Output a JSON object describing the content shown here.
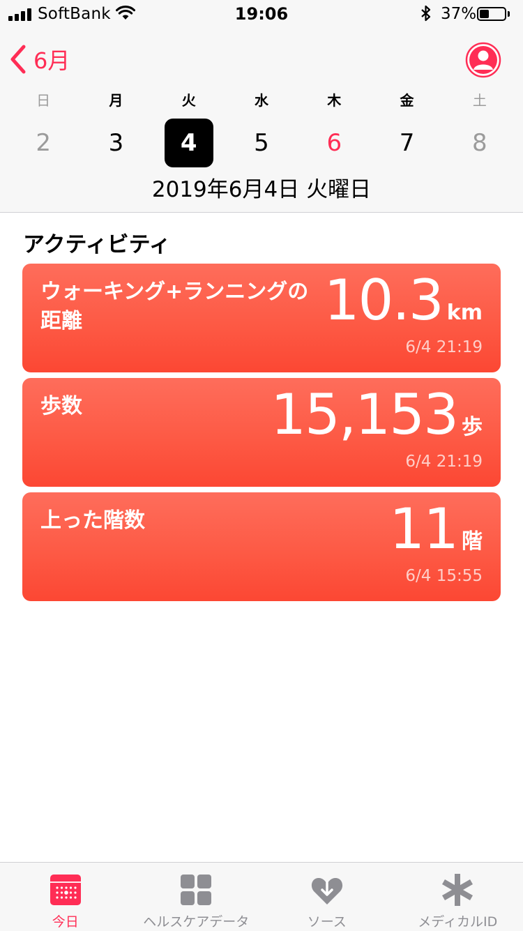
{
  "status_bar": {
    "carrier": "SoftBank",
    "time": "19:06",
    "battery_percent": "37%",
    "battery_level": 0.37
  },
  "nav": {
    "back_label": "6月"
  },
  "week": {
    "weekdays": [
      "日",
      "月",
      "火",
      "水",
      "木",
      "金",
      "土"
    ],
    "days": [
      "2",
      "3",
      "4",
      "5",
      "6",
      "7",
      "8"
    ],
    "selected_index": 2,
    "today_index": 4
  },
  "selected_date": "2019年6月4日 火曜日",
  "section_title": "アクティビティ",
  "cards": [
    {
      "title": "ウォーキング+ランニングの距離",
      "value": "10.3",
      "unit": "km",
      "timestamp": "6/4 21:19"
    },
    {
      "title": "歩数",
      "value": "15,153",
      "unit": "歩",
      "timestamp": "6/4 21:19"
    },
    {
      "title": "上った階数",
      "value": "11",
      "unit": "階",
      "timestamp": "6/4 15:55"
    }
  ],
  "tabbar": {
    "tabs": [
      {
        "label": "今日",
        "icon": "calendar-today-icon",
        "active": true
      },
      {
        "label": "ヘルスケアデータ",
        "icon": "grid-icon",
        "active": false
      },
      {
        "label": "ソース",
        "icon": "heart-download-icon",
        "active": false
      },
      {
        "label": "メディカルID",
        "icon": "asterisk-icon",
        "active": false
      }
    ]
  },
  "colors": {
    "accent": "#ff2d55",
    "card_top": "#fe6d5b",
    "card_bottom": "#fc4733",
    "inactive": "#8e8e93"
  }
}
